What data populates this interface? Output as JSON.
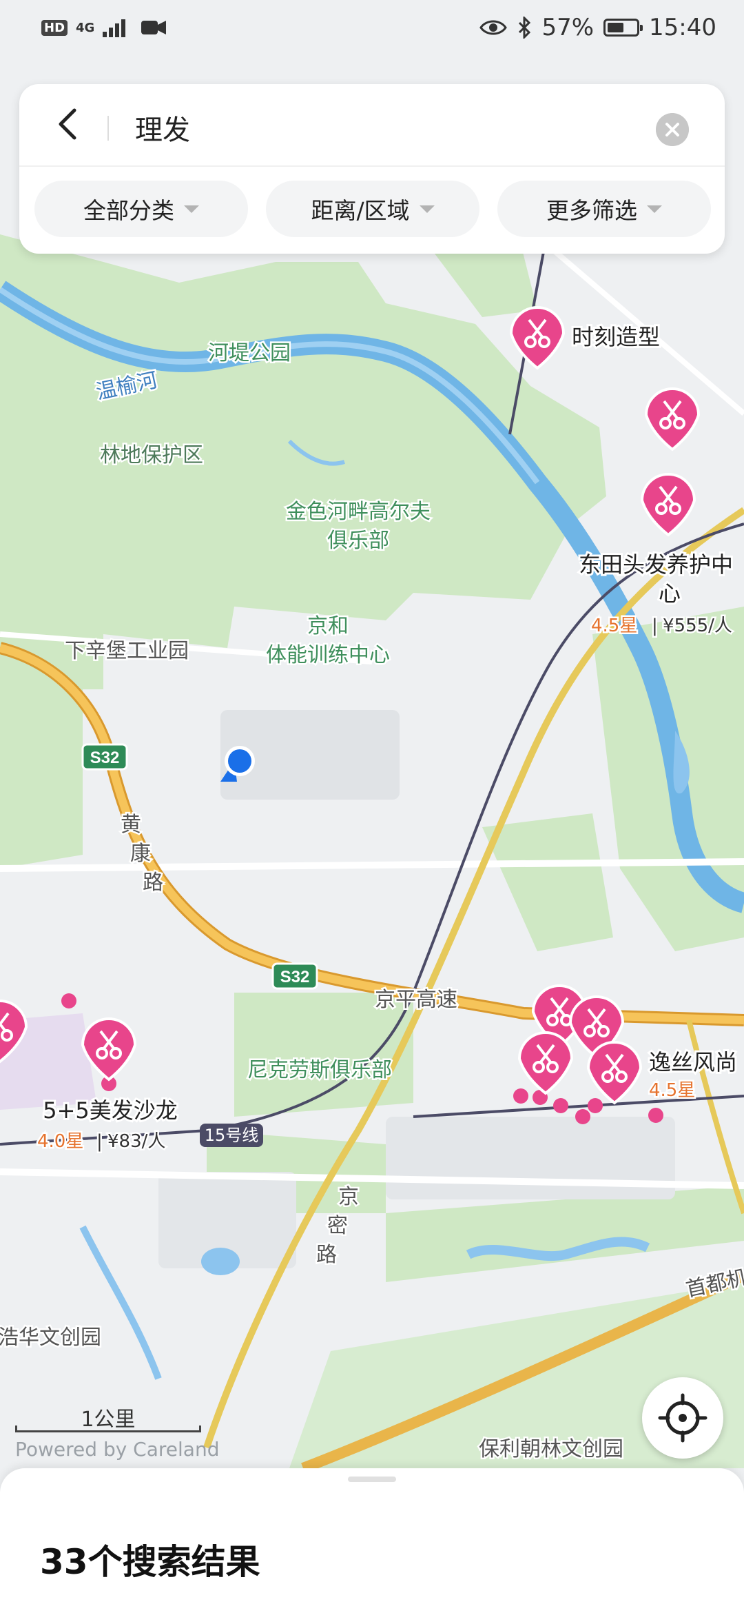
{
  "status_bar": {
    "network": "HD",
    "signal": "4G",
    "battery": "57%",
    "battery_level": 0.57,
    "time": "15:40"
  },
  "search": {
    "query": "理发"
  },
  "filters": [
    {
      "label": "全部分类"
    },
    {
      "label": "距离/区域"
    },
    {
      "label": "更多筛选"
    }
  ],
  "map_labels": {
    "park1": "河堤公园",
    "river": "温榆河",
    "forest": "林地保护区",
    "golf1": "金色河畔高尔夫",
    "golf2": "俱乐部",
    "industrial": "下辛堡工业园",
    "jinghe1": "京和",
    "jinghe2": "体能训练中心",
    "road_s32": "S32",
    "huangkang": "黄康路",
    "jingping": "京平高速",
    "nicklaus": "尼克劳斯俱乐部",
    "line15": "15号线",
    "jingmi": "京密路",
    "huawen": "浩华文创园",
    "shoudu": "首都机",
    "poly": "保利朝林文创园"
  },
  "pois": [
    {
      "name": "时刻造型"
    },
    {
      "name": "东田头发养护中",
      "name2": "心",
      "rating": "4.5星",
      "price": "¥555/人"
    },
    {
      "name": "5+5美发沙龙",
      "rating": "4.0星",
      "price": "¥83/人"
    },
    {
      "name": "逸丝风尚",
      "rating": "4.5星"
    }
  ],
  "scale": "1公里",
  "powered_by": "Powered by Careland",
  "results_title": "33个搜索结果",
  "colors": {
    "poi_pink": "#e8458b",
    "water": "#6fb5e6",
    "green": "#cfe8c4",
    "highway": "#f2b84b",
    "subway": "#4b4b66",
    "location": "#1a6fe8"
  }
}
